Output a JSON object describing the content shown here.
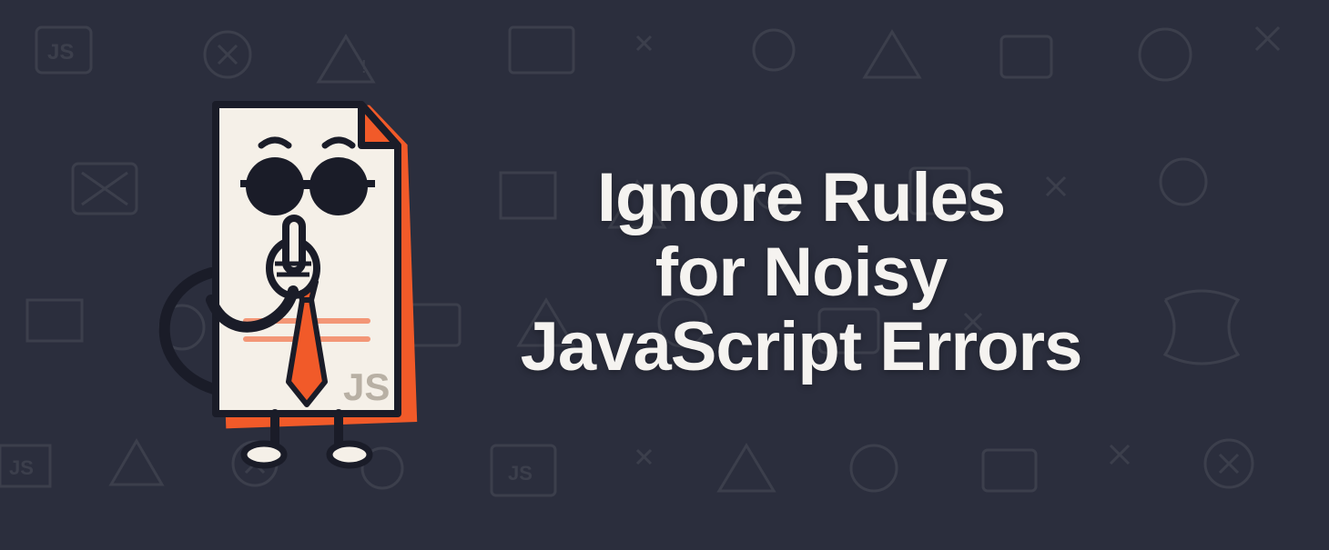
{
  "title": {
    "line1": "Ignore Rules",
    "line2": "for Noisy",
    "line3": "JavaScript Errors"
  },
  "mascot": {
    "label": "JS",
    "description": "document-character-with-glasses-shushing"
  },
  "colors": {
    "background": "#2b2e3d",
    "text": "#f5f3f0",
    "accent_orange": "#f15a29",
    "paper": "#f5f0e8",
    "dark_stroke": "#1a1c28"
  }
}
